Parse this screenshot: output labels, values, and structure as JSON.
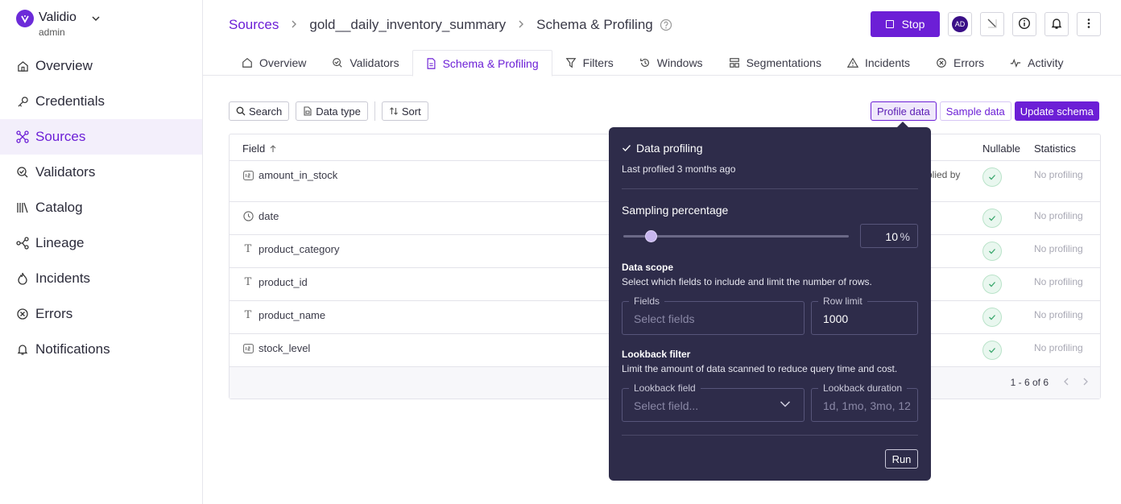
{
  "app": {
    "name": "Validio",
    "role": "admin"
  },
  "sidebar": {
    "items": [
      {
        "label": "Overview",
        "icon": "home-icon"
      },
      {
        "label": "Credentials",
        "icon": "key-icon"
      },
      {
        "label": "Sources",
        "icon": "sources-icon",
        "active": true
      },
      {
        "label": "Validators",
        "icon": "validators-icon"
      },
      {
        "label": "Catalog",
        "icon": "catalog-icon"
      },
      {
        "label": "Lineage",
        "icon": "lineage-icon"
      },
      {
        "label": "Incidents",
        "icon": "flame-icon"
      },
      {
        "label": "Errors",
        "icon": "error-icon"
      },
      {
        "label": "Notifications",
        "icon": "bell-icon"
      }
    ]
  },
  "breadcrumb": {
    "root": "Sources",
    "source": "gold__daily_inventory_summary",
    "page": "Schema & Profiling"
  },
  "header": {
    "stop_label": "Stop",
    "avatar_initials": "AD"
  },
  "tabs": [
    {
      "label": "Overview"
    },
    {
      "label": "Validators"
    },
    {
      "label": "Schema & Profiling",
      "active": true
    },
    {
      "label": "Filters"
    },
    {
      "label": "Windows"
    },
    {
      "label": "Segmentations"
    },
    {
      "label": "Incidents"
    },
    {
      "label": "Errors"
    },
    {
      "label": "Activity"
    }
  ],
  "toolbar": {
    "search": "Search",
    "data_type": "Data type",
    "sort": "Sort"
  },
  "actions": {
    "profile_data": "Profile data",
    "sample_data": "Sample data",
    "update_schema": "Update schema"
  },
  "table": {
    "headers": {
      "field": "Field",
      "nullable": "Nullable",
      "statistics": "Statistics"
    },
    "rows": [
      {
        "type_icon": "number-icon",
        "name": "amount_in_stock",
        "status": "No profiling",
        "note": "plied by"
      },
      {
        "type_icon": "clock-icon",
        "name": "date",
        "status": "No profiling"
      },
      {
        "type_icon": "text-icon",
        "name": "product_category",
        "status": "No profiling"
      },
      {
        "type_icon": "text-icon",
        "name": "product_id",
        "status": "No profiling"
      },
      {
        "type_icon": "text-icon",
        "name": "product_name",
        "status": "No profiling"
      },
      {
        "type_icon": "number-icon",
        "name": "stock_level",
        "status": "No profiling"
      }
    ],
    "pagination": "1 - 6 of 6"
  },
  "popover": {
    "title": "Data profiling",
    "last_profiled": "Last profiled 3 months ago",
    "sampling_label": "Sampling percentage",
    "sampling_value": "10",
    "sampling_unit": "%",
    "sampling_fraction": 0.1,
    "data_scope_title": "Data scope",
    "data_scope_desc": "Select which fields to include and limit the number of rows.",
    "fields_label": "Fields",
    "fields_placeholder": "Select fields",
    "row_limit_label": "Row limit",
    "row_limit_value": "1000",
    "lookback_title": "Lookback filter",
    "lookback_desc": "Limit the amount of data scanned to reduce query time and cost.",
    "lookback_field_label": "Lookback field",
    "lookback_field_placeholder": "Select field...",
    "lookback_duration_label": "Lookback duration",
    "lookback_duration_placeholder": "1d, 1mo, 3mo, 12",
    "run_label": "Run"
  },
  "colors": {
    "accent": "#6c1fd6",
    "popover_bg": "#2e2c4a",
    "success": "#3aa76d"
  }
}
